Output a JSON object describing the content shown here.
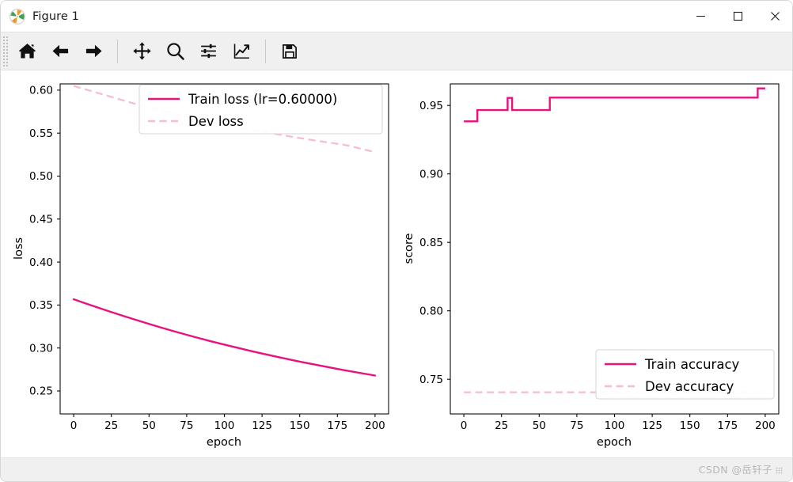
{
  "window": {
    "title": "Figure 1",
    "icon": "matplotlib-logo",
    "minimize_label": "—",
    "maximize_label": "□",
    "close_label": "✕"
  },
  "toolbar": {
    "buttons": [
      {
        "name": "home-icon",
        "tooltip": "Reset original view"
      },
      {
        "name": "back-arrow-icon",
        "tooltip": "Back to previous view"
      },
      {
        "name": "forward-arrow-icon",
        "tooltip": "Forward to next view"
      },
      {
        "name": "pan-move-icon",
        "tooltip": "Pan axes with left mouse, zoom with right"
      },
      {
        "name": "zoom-magnifier-icon",
        "tooltip": "Zoom to rectangle"
      },
      {
        "name": "subplot-config-icon",
        "tooltip": "Configure subplots"
      },
      {
        "name": "edit-curve-icon",
        "tooltip": "Edit axis, curve and image parameters"
      },
      {
        "name": "save-floppy-icon",
        "tooltip": "Save the figure"
      }
    ]
  },
  "statusbar": {
    "coordinates": "",
    "watermark": "CSDN @岳轩子"
  },
  "colors": {
    "train": "#E8127F",
    "dev": "#F6BCD6",
    "axis": "#000000",
    "background": "#FFFFFF"
  },
  "chart_data": [
    {
      "type": "line",
      "id": "loss-plot",
      "title": "",
      "xlabel": "epoch",
      "ylabel": "loss",
      "xlim": [
        -9,
        209
      ],
      "ylim": [
        0.228,
        0.612
      ],
      "xticks": [
        0,
        25,
        50,
        75,
        100,
        125,
        150,
        175,
        200
      ],
      "yticks": [
        0.25,
        0.3,
        0.35,
        0.4,
        0.45,
        0.5,
        0.55,
        0.6
      ],
      "xticklabels": [
        "0",
        "25",
        "50",
        "75",
        "100",
        "125",
        "150",
        "175",
        "200"
      ],
      "yticklabels": [
        "0.25",
        "0.30",
        "0.35",
        "0.40",
        "0.45",
        "0.50",
        "0.55",
        "0.60"
      ],
      "grid": false,
      "legend_position": "upper center",
      "series": [
        {
          "name": "Train loss (lr=0.60000)",
          "style": "solid",
          "color": "#E8127F",
          "x": [
            0,
            10,
            20,
            30,
            40,
            50,
            60,
            70,
            80,
            90,
            100,
            110,
            120,
            130,
            140,
            150,
            160,
            170,
            180,
            190,
            200
          ],
          "y": [
            0.3445,
            0.3385,
            0.3325,
            0.3268,
            0.3212,
            0.3159,
            0.3107,
            0.3057,
            0.301,
            0.2965,
            0.2922,
            0.2881,
            0.2842,
            0.2805,
            0.277,
            0.2737,
            0.2706,
            0.2676,
            0.2648,
            0.2621,
            0.2595
          ]
        },
        {
          "name": "Dev loss",
          "style": "dashed",
          "color": "#F6BCD6",
          "x": [
            0,
            20,
            40,
            60,
            80,
            100,
            120,
            140,
            160,
            180,
            200
          ],
          "y": [
            0.593,
            0.5828,
            0.5726,
            0.5634,
            0.5556,
            0.5482,
            0.5415,
            0.5353,
            0.5296,
            0.5244,
            0.516
          ]
        }
      ]
    },
    {
      "type": "line",
      "id": "score-plot",
      "title": "",
      "xlabel": "epoch",
      "ylabel": "score",
      "xlim": [
        -9,
        209
      ],
      "ylim": [
        0.7245,
        0.9655
      ],
      "xticks": [
        0,
        25,
        50,
        75,
        100,
        125,
        150,
        175,
        200
      ],
      "yticks": [
        0.75,
        0.8,
        0.85,
        0.9,
        0.95
      ],
      "xticklabels": [
        "0",
        "25",
        "50",
        "75",
        "100",
        "125",
        "150",
        "175",
        "200"
      ],
      "yticklabels": [
        "0.75",
        "0.80",
        "0.85",
        "0.90",
        "0.95"
      ],
      "grid": false,
      "legend_position": "lower right",
      "series": [
        {
          "name": "Train accuracy",
          "style": "solid",
          "color": "#E8127F",
          "x": [
            0,
            9,
            10,
            39,
            40,
            43,
            44,
            57,
            58,
            195,
            196,
            200
          ],
          "y": [
            0.933,
            0.933,
            0.9412,
            0.9412,
            0.9501,
            0.9501,
            0.9412,
            0.9412,
            0.9503,
            0.9503,
            0.957,
            0.957
          ]
        },
        {
          "name": "Dev accuracy",
          "style": "dashed",
          "color": "#F6BCD6",
          "x": [
            0,
            50,
            100,
            150,
            200
          ],
          "y": [
            0.734,
            0.734,
            0.734,
            0.734,
            0.734
          ]
        }
      ]
    }
  ]
}
